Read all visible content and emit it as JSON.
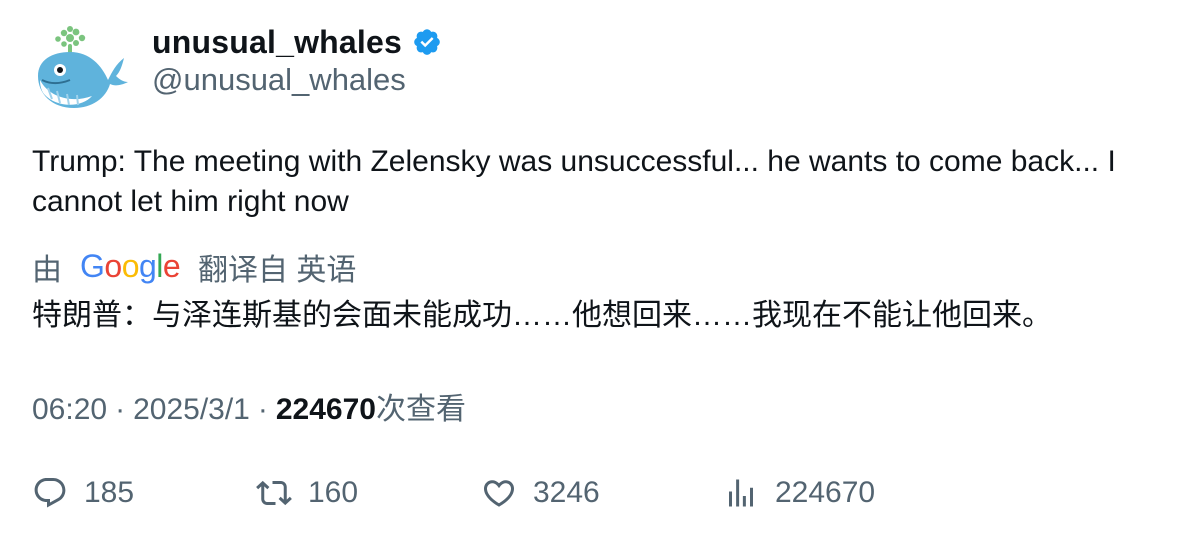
{
  "author": {
    "display_name": "unusual_whales",
    "handle": "@unusual_whales",
    "avatar_icon": "whale-icon",
    "verified_icon": "verified-badge-icon",
    "verified_color": "#1d9bf0"
  },
  "tweet": {
    "text": "Trump: The meeting with Zelensky was unsuccessful... he wants to come back... I cannot let him right now"
  },
  "translation": {
    "by_label": "由",
    "provider_icon": "google-logo",
    "provider_text": "Google",
    "from_label": "翻译自 英语",
    "text": "特朗普：与泽连斯基的会面未能成功……他想回来……我现在不能让他回来。"
  },
  "meta": {
    "time": "06:20",
    "separator": "·",
    "date": "2025/3/1",
    "views_count": "224670",
    "views_label": "次查看"
  },
  "actions": {
    "replies": {
      "icon": "reply-icon",
      "count": "185"
    },
    "retweets": {
      "icon": "retweet-icon",
      "count": "160"
    },
    "likes": {
      "icon": "heart-icon",
      "count": "3246"
    },
    "views": {
      "icon": "analytics-icon",
      "count": "224670"
    }
  },
  "colors": {
    "text_primary": "#0f1419",
    "text_secondary": "#536471",
    "accent": "#1d9bf0"
  }
}
